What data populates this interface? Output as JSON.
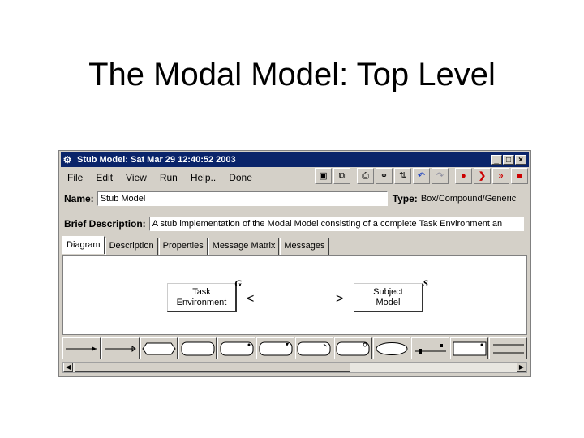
{
  "slide": {
    "title": "The Modal Model: Top Level"
  },
  "window": {
    "title": "Stub Model: Sat Mar 29 12:40:52 2003",
    "app_icon": "gear-icon",
    "minimize": "_",
    "maximize": "□",
    "close": "×"
  },
  "menu": {
    "items": [
      "File",
      "Edit",
      "View",
      "Run",
      "Help..",
      "Done"
    ]
  },
  "toolbar": {
    "icons": [
      "save-icon",
      "save-all-icon",
      "print-icon",
      "find-icon",
      "sort-icon",
      "undo-icon",
      "redo-icon",
      "record-icon",
      "step-icon",
      "run-icon",
      "stop-icon"
    ],
    "glyphs": [
      "▣",
      "⧉",
      "⎙",
      "⚭",
      "⇅",
      "↶",
      "↷",
      "●",
      "❯",
      "»",
      "■"
    ]
  },
  "name_row": {
    "label": "Name:",
    "value": "Stub Model",
    "type_label": "Type:",
    "type_value": "Box/Compound/Generic"
  },
  "desc_row": {
    "label": "Brief Description:",
    "value": "A stub implementation of the Modal Model consisting of a complete Task Environment an"
  },
  "tabs": [
    "Diagram",
    "Description",
    "Properties",
    "Message Matrix",
    "Messages"
  ],
  "diagram": {
    "node_task": {
      "line1": "Task",
      "line2": "Environment",
      "tag": "G"
    },
    "node_subject": {
      "line1": "Subject",
      "line2": "Model",
      "tag": "S"
    },
    "port_left": "<",
    "port_right": ">"
  },
  "palette": {
    "items": [
      "arrow-left-tool",
      "arrow-right-tool",
      "hexagon-tool",
      "rounded-box-tool",
      "rounded-box-dot-tool",
      "rounded-box-notch-tool",
      "rounded-box-arrow-tool",
      "rounded-box-corner-tool",
      "ellipse-tool",
      "line-tool",
      "box-tool",
      "lines-tool"
    ]
  }
}
